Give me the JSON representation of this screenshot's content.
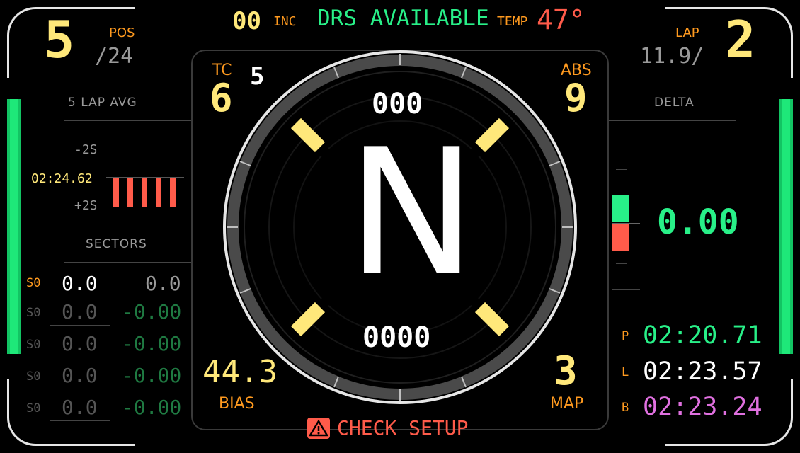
{
  "top": {
    "inc_value": "00",
    "inc_label": "INC",
    "drs": "DRS AVAILABLE",
    "temp_label": "TEMP",
    "temp_value": "47°"
  },
  "position": {
    "value": "5",
    "label": "POS",
    "total": "/24"
  },
  "lap": {
    "label": "LAP",
    "fraction": "11.9/",
    "value": "2"
  },
  "tc": {
    "label": "TC",
    "value": "6",
    "sub": "5"
  },
  "abs": {
    "label": "ABS",
    "value": "9"
  },
  "lap_avg": {
    "title": "5 LAP AVG",
    "minus": "-2S",
    "plus": "+2S",
    "time": "02:24.62",
    "bars": 5
  },
  "sectors": {
    "title": "SECTORS",
    "rows": [
      {
        "label": "S0",
        "a": "0.0",
        "b": "0.0"
      },
      {
        "label": "S0",
        "a": "0.0",
        "b": "-0.00"
      },
      {
        "label": "S0",
        "a": "0.0",
        "b": "-0.00"
      },
      {
        "label": "S0",
        "a": "0.0",
        "b": "-0.00"
      },
      {
        "label": "S0",
        "a": "0.0",
        "b": "-0.00"
      }
    ]
  },
  "gauge": {
    "gear": "N",
    "speed": "000",
    "rpm": "0000"
  },
  "bias": {
    "value": "44.3",
    "label": "BIAS"
  },
  "map": {
    "value": "3",
    "label": "MAP"
  },
  "delta": {
    "title": "DELTA",
    "value": "0.00"
  },
  "times": [
    {
      "label": "P",
      "value": "02:20.71"
    },
    {
      "label": "L",
      "value": "02:23.57"
    },
    {
      "label": "B",
      "value": "02:23.24"
    }
  ],
  "warning": {
    "icon": "warning-icon",
    "text": "CHECK SETUP"
  },
  "colors": {
    "accent_yellow": "#ffe87a",
    "accent_orange": "#ff9a1f",
    "green": "#28f088",
    "red": "#ff5b4a",
    "purple": "#e070e0"
  }
}
